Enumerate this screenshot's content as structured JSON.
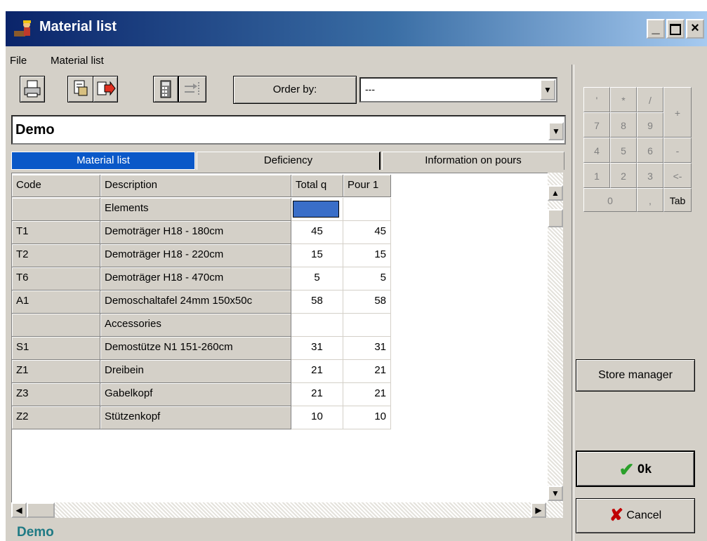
{
  "window": {
    "title": "Material list"
  },
  "menu": [
    "File",
    "Material list"
  ],
  "toolbar": {
    "icons": [
      "print-icon",
      "export-icon",
      "export-red-icon",
      "calculator-icon",
      "transfer-icon"
    ],
    "order_by_label": "Order by:",
    "order_by_value": "---"
  },
  "project": {
    "value": "Demo"
  },
  "tabs": [
    "Material list",
    "Deficiency",
    "Information on pours"
  ],
  "table": {
    "headers": [
      "Code",
      "Description",
      "Total q",
      "Pour 1"
    ],
    "rows": [
      {
        "code": "",
        "desc": "Elements",
        "total": "",
        "pour": ""
      },
      {
        "code": "T1",
        "desc": "Demoträger H18 - 180cm",
        "total": "45",
        "pour": "45"
      },
      {
        "code": "T2",
        "desc": "Demoträger H18 - 220cm",
        "total": "15",
        "pour": "15"
      },
      {
        "code": "T6",
        "desc": "Demoträger H18 - 470cm",
        "total": "5",
        "pour": "5"
      },
      {
        "code": "A1",
        "desc": "Demoschaltafel 24mm 150x50c",
        "total": "58",
        "pour": "58"
      },
      {
        "code": "",
        "desc": "Accessories",
        "total": "",
        "pour": ""
      },
      {
        "code": "S1",
        "desc": "Demostütze N1 151-260cm",
        "total": "31",
        "pour": "31"
      },
      {
        "code": "Z1",
        "desc": "Dreibein",
        "total": "21",
        "pour": "21"
      },
      {
        "code": "Z3",
        "desc": "Gabelkopf",
        "total": "21",
        "pour": "21"
      },
      {
        "code": "Z2",
        "desc": "Stützenkopf",
        "total": "10",
        "pour": "10"
      }
    ]
  },
  "status": "Demo",
  "keypad": {
    "row1": [
      "'",
      "*",
      "/"
    ],
    "plus": "+",
    "row2": [
      "7",
      "8",
      "9"
    ],
    "row3": [
      "4",
      "5",
      "6"
    ],
    "minus": "-",
    "row4": [
      "1",
      "2",
      "3"
    ],
    "back": "<-",
    "zero": "0",
    "comma": ",",
    "tab": "Tab"
  },
  "buttons": {
    "store_manager": "Store manager",
    "ok": "Ok",
    "cancel": "Cancel"
  },
  "colors": {
    "title_start": "#0a246a",
    "title_end": "#a6caf0",
    "tab_active": "#0a58c8",
    "status_text": "#1f7a84",
    "selected_cell": "#3a6ec8",
    "ok_check": "#2aa02a",
    "cancel_x": "#c00000"
  }
}
